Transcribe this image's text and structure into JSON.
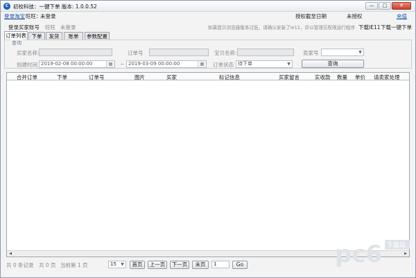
{
  "titlebar": {
    "title": "初校科技：一键下单   版本: 1.0.0.52",
    "min": "—",
    "max": "□",
    "close": "✕"
  },
  "account_row": {
    "login_link": "登录淘宝",
    "wangwang_label": "旺旺：",
    "wangwang_value": "未登录",
    "auth_date_label": "授权截至日期",
    "auth_date_value": "未授权",
    "recharge_link": "充值"
  },
  "buyer_row": {
    "login_buyer": "登录买家账号",
    "wangwang": "旺旺",
    "status": "未登录",
    "hint": "如果提示浏览器版本过低，请确认安装了ie11，并以管理员权限运行程序",
    "download_ie": "下载IE11",
    "download_app": "下载一键下单"
  },
  "tabs": [
    {
      "label": "订单列表",
      "active": true
    },
    {
      "label": "下单",
      "active": false
    },
    {
      "label": "发货",
      "active": false
    },
    {
      "label": "账单",
      "active": false
    },
    {
      "label": "参数配置",
      "active": false
    }
  ],
  "query": {
    "legend": "查询",
    "buyer_name_label": "买家名称:",
    "order_no_label": "订单号",
    "item_name_label": "宝贝名称:",
    "seller_label": "卖家号",
    "create_time_label": "创建时间",
    "date_from": "2019-02-08 00:00:00",
    "range_sep": "~",
    "date_to": "2019-03-09 00:00:00",
    "order_status_label": "订单状态",
    "order_status_value": "待下单",
    "query_button": "查询"
  },
  "grid": {
    "columns": [
      "合并订单",
      "下单",
      "订单号",
      "图片",
      "买家",
      "标记信息",
      "买家留言",
      "实收款",
      "数量",
      "单价",
      "请卖家处理"
    ]
  },
  "footer": {
    "total_records": "共 0 条记录",
    "total_pages": "共 0 页",
    "current_page": "当前第 1 页",
    "page_size": "15",
    "first": "首页",
    "prev": "上一页",
    "next": "下一页",
    "last": "末页",
    "page_input": "1",
    "go": "Go"
  },
  "watermark": {
    "brand": "pc6",
    "sub": "下载站"
  },
  "colors": {
    "accent": "#1c4fb0",
    "watermark": "#d9dde3"
  }
}
